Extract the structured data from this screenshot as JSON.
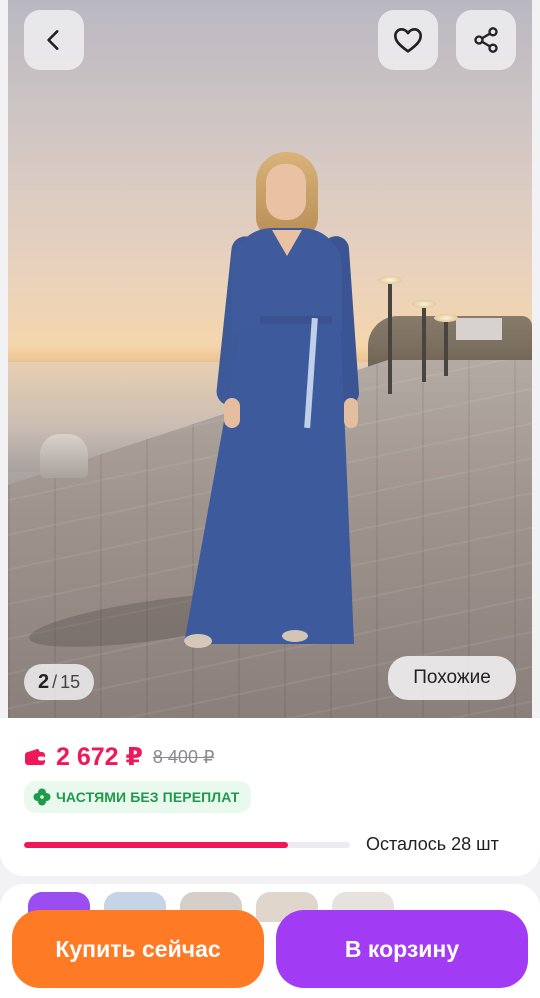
{
  "gallery": {
    "current": "2",
    "separator": "/",
    "total": "15",
    "similar_label": "Похожие"
  },
  "header": {
    "back_icon": "chevron-left-icon",
    "favorite_icon": "heart-icon",
    "share_icon": "share-icon"
  },
  "product": {
    "price": "2 672 ₽",
    "old_price": "8 400 ₽",
    "installment_label": "ЧАСТЯМИ БЕЗ ПЕРЕПЛАТ",
    "stock_label": "Осталось 28 шт",
    "stock_fraction": 0.81
  },
  "actions": {
    "buy_now_label": "Купить сейчас",
    "add_to_cart_label": "В корзину"
  },
  "colors": {
    "accent_price": "#f1185a",
    "buy_button": "#ff7a25",
    "cart_button": "#a23cf4",
    "installment_green": "#1f9a4a"
  }
}
